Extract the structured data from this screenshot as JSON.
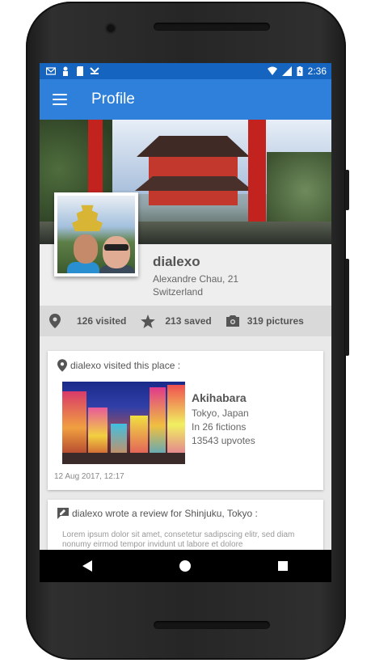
{
  "status_bar": {
    "time": "2:36",
    "left_icons": [
      "mail-icon",
      "user-icon",
      "sd-card-icon",
      "download-icon"
    ],
    "right_icons": [
      "wifi-icon",
      "signal-icon",
      "battery-charging-icon"
    ]
  },
  "app_bar": {
    "title": "Profile",
    "menu_icon": "hamburger-menu-icon",
    "color": "#2f80db"
  },
  "profile": {
    "username": "dialexo",
    "full_name_age": "Alexandre Chau, 21",
    "country": "Switzerland"
  },
  "stats": [
    {
      "icon": "location-pin-icon",
      "label": "126 visited"
    },
    {
      "icon": "star-icon",
      "label": "213 saved"
    },
    {
      "icon": "camera-icon",
      "label": "319 pictures"
    }
  ],
  "feed": {
    "visit_card": {
      "header": "dialexo visited this place :",
      "place_name": "Akihabara",
      "location": "Tokyo, Japan",
      "fictions": "In 26 fictions",
      "upvotes": "13543 upvotes",
      "date": "12 Aug 2017, 12:17"
    },
    "review_card": {
      "header": "dialexo wrote a review for Shinjuku, Tokyo :",
      "text": "Lorem ipsum dolor sit amet, consetetur sadipscing elitr, sed diam nonumy eirmod tempor invidunt ut labore et dolore"
    }
  },
  "nav_bar": [
    "back-icon",
    "home-icon",
    "recents-icon"
  ]
}
